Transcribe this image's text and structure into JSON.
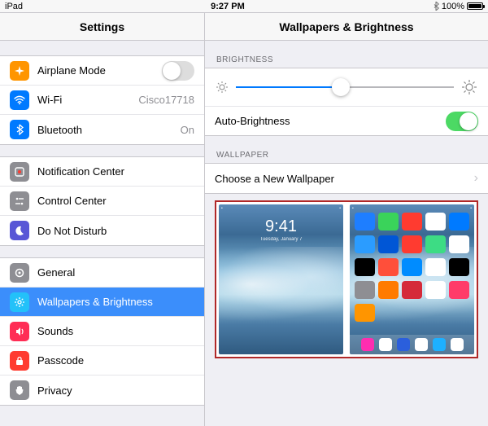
{
  "statusbar": {
    "device": "iPad",
    "time": "9:27 PM",
    "battery": "100%"
  },
  "header": {
    "left_title": "Settings",
    "right_title": "Wallpapers & Brightness"
  },
  "sidebar": {
    "groups": [
      {
        "items": [
          {
            "name": "airplane-mode",
            "label": "Airplane Mode",
            "icon_bg": "#ff9500",
            "accessory_type": "switch",
            "switch_on": false
          },
          {
            "name": "wifi",
            "label": "Wi-Fi",
            "icon_bg": "#007aff",
            "accessory_type": "value",
            "accessory": "Cisco17718"
          },
          {
            "name": "bluetooth",
            "label": "Bluetooth",
            "icon_bg": "#007aff",
            "accessory_type": "value",
            "accessory": "On"
          }
        ]
      },
      {
        "items": [
          {
            "name": "notification-center",
            "label": "Notification Center",
            "icon_bg": "#8e8e93"
          },
          {
            "name": "control-center",
            "label": "Control Center",
            "icon_bg": "#8e8e93"
          },
          {
            "name": "do-not-disturb",
            "label": "Do Not Disturb",
            "icon_bg": "#5856d6"
          }
        ]
      },
      {
        "items": [
          {
            "name": "general",
            "label": "General",
            "icon_bg": "#8e8e93"
          },
          {
            "name": "wallpapers-brightness",
            "label": "Wallpapers & Brightness",
            "icon_bg": "#23c1f9",
            "selected": true
          },
          {
            "name": "sounds",
            "label": "Sounds",
            "icon_bg": "#ff2d55"
          },
          {
            "name": "passcode",
            "label": "Passcode",
            "icon_bg": "#ff3b30"
          },
          {
            "name": "privacy",
            "label": "Privacy",
            "icon_bg": "#8e8e93"
          }
        ]
      }
    ]
  },
  "detail": {
    "brightness_header": "BRIGHTNESS",
    "auto_brightness_label": "Auto-Brightness",
    "auto_brightness_on": true,
    "wallpaper_header": "WALLPAPER",
    "choose_wallpaper_label": "Choose a New Wallpaper",
    "brightness_value_percent": 48
  },
  "preview": {
    "lock_time": "9:41",
    "lock_date": "Tuesday, January 7",
    "home_apps": [
      "#1e7eff",
      "#3ad35a",
      "#ff3b30",
      "#ffffff",
      "#007aff",
      "#2b9cff",
      "#0056d6",
      "#ff3b30",
      "#3ddc84",
      "#ffffff",
      "#000000",
      "#ff4f3a",
      "#008cff",
      "#ffffff",
      "#000000",
      "#8e8e93",
      "#ff7b00",
      "#d52a3a",
      "#ffffff",
      "#ff3b69",
      "#ff9500"
    ],
    "dock_apps": [
      "#ff2db0",
      "#ffffff",
      "#2b5fdc",
      "#ffffff",
      "#1db0ff",
      "#ffffff"
    ]
  }
}
